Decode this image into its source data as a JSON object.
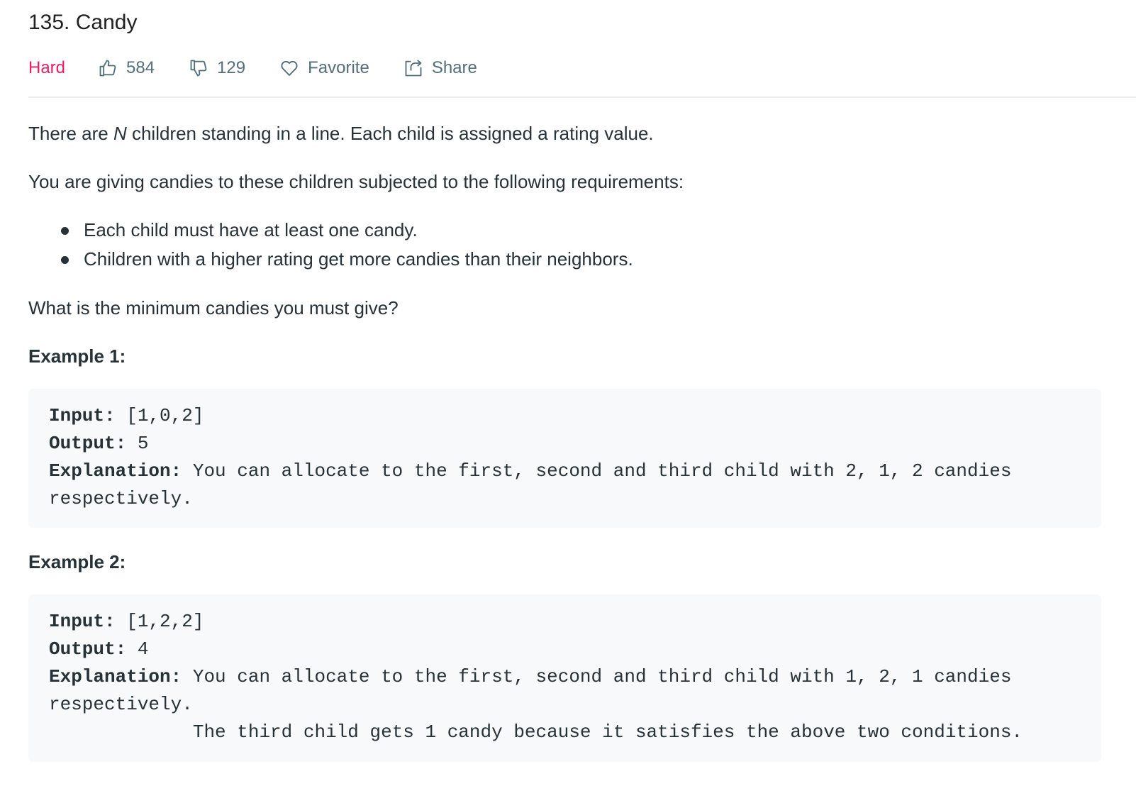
{
  "problem": {
    "title": "135. Candy",
    "difficulty": "Hard",
    "likes": "584",
    "dislikes": "129",
    "favorite_label": "Favorite",
    "share_label": "Share"
  },
  "description": {
    "p1_before": "There are ",
    "p1_var": "N",
    "p1_after": " children standing in a line. Each child is assigned a rating value.",
    "p2": "You are giving candies to these children subjected to the following requirements:",
    "requirements": [
      "Each child must have at least one candy.",
      "Children with a higher rating get more candies than their neighbors."
    ],
    "p3": "What is the minimum candies you must give?"
  },
  "examples": [
    {
      "heading": "Example 1:",
      "input_label": "Input:",
      "input_value": " [1,0,2]",
      "output_label": "Output:",
      "output_value": " 5",
      "explanation_label": "Explanation:",
      "explanation_line1": " You can allocate to the first, second and third child with 2, 1, 2 candies",
      "explanation_line2": "respectively."
    },
    {
      "heading": "Example 2:",
      "input_label": "Input:",
      "input_value": " [1,2,2]",
      "output_label": "Output:",
      "output_value": " 4",
      "explanation_label": "Explanation:",
      "explanation_line1": " You can allocate to the first, second and third child with 1, 2, 1 candies",
      "explanation_line2": "respectively.",
      "explanation_line3": "             The third child gets 1 candy because it satisfies the above two conditions."
    }
  ],
  "colors": {
    "difficulty_hard": "#e91e63",
    "meta_text": "#546e7a",
    "code_bg": "#f7f9fa",
    "divider": "#eceff1"
  },
  "icons": {
    "likes": "thumbs-up-icon",
    "dislikes": "thumbs-down-icon",
    "favorite": "heart-icon",
    "share": "share-icon"
  }
}
